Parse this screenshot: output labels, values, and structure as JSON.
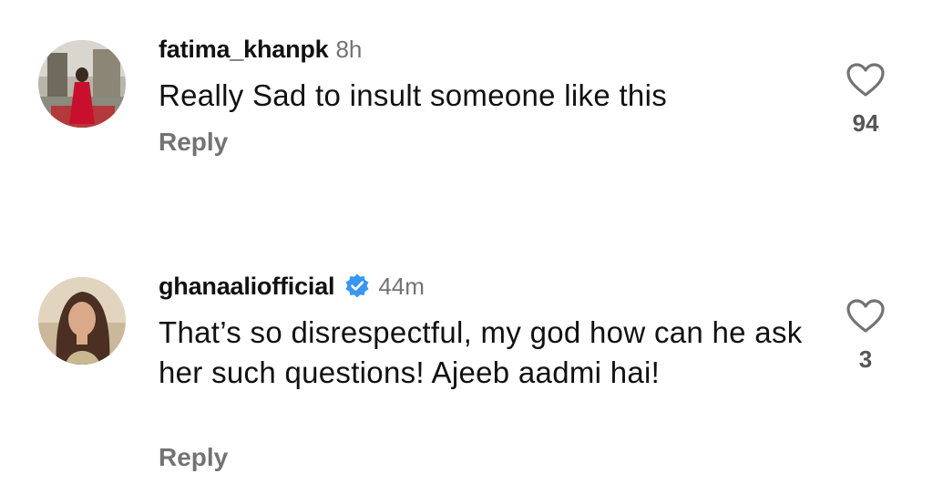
{
  "comments": [
    {
      "username": "fatima_khanpk",
      "time": "8h",
      "verified": false,
      "text": "Really Sad to insult someone like this",
      "reply_label": "Reply",
      "likes": "94"
    },
    {
      "username": "ghanaaliofficial",
      "time": "44m",
      "verified": true,
      "text": "That’s so disrespectful, my god how can he ask her such questions! Ajeeb aadmi hai!",
      "reply_label": "Reply",
      "likes": "3"
    }
  ],
  "colors": {
    "secondary_text": "#737373",
    "verified_badge": "#3897f0"
  },
  "icons": {
    "like": "heart-outline-icon",
    "verified": "verified-badge-icon"
  }
}
